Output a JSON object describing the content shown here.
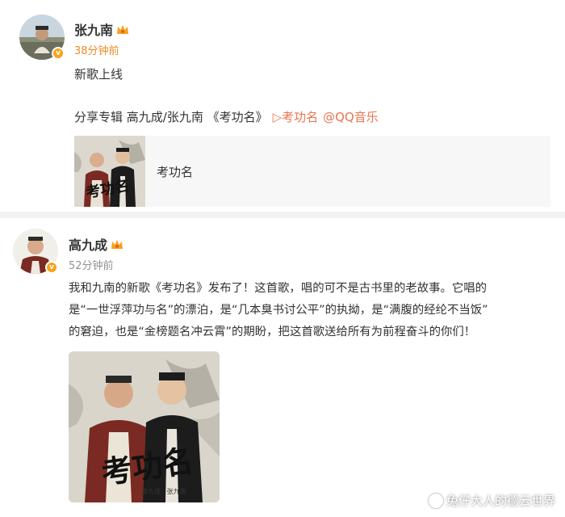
{
  "post1": {
    "username": "张九南",
    "timestamp": "38分钟前",
    "line1": "新歌上线",
    "share_prefix": "分享专辑 高九成/张九南 《考功名》",
    "share_link1": "▷考功名",
    "share_link2": "@QQ音乐",
    "card_title": "考功名",
    "card_cover_text": "考功名"
  },
  "post2": {
    "username": "高九成",
    "timestamp": "52分钟前",
    "body_line1": "我和九南的新歌《考功名》发布了！这首歌，唱的可不是古书里的老故事。它唱的",
    "body_line2": "是“一世浮萍功与名”的漂泊，是“几本臭书讨公平”的执拗，是“满腹的经纶不当饭”",
    "body_line3": "的窘迫，也是“金榜题名冲云霄”的期盼，把这首歌送给所有为前程奋斗的你们！",
    "album_cover_text": "考功名",
    "album_cover_names": "高九成   张九南"
  },
  "watermark": {
    "text": "兔仔大人的德云世界",
    "icon": "weibo-camera-icon"
  },
  "colors": {
    "timestamp_orange": "#f08a24",
    "timestamp_gray": "#939393",
    "link": "#eb7350",
    "verified_badge": "#f7a21b"
  }
}
